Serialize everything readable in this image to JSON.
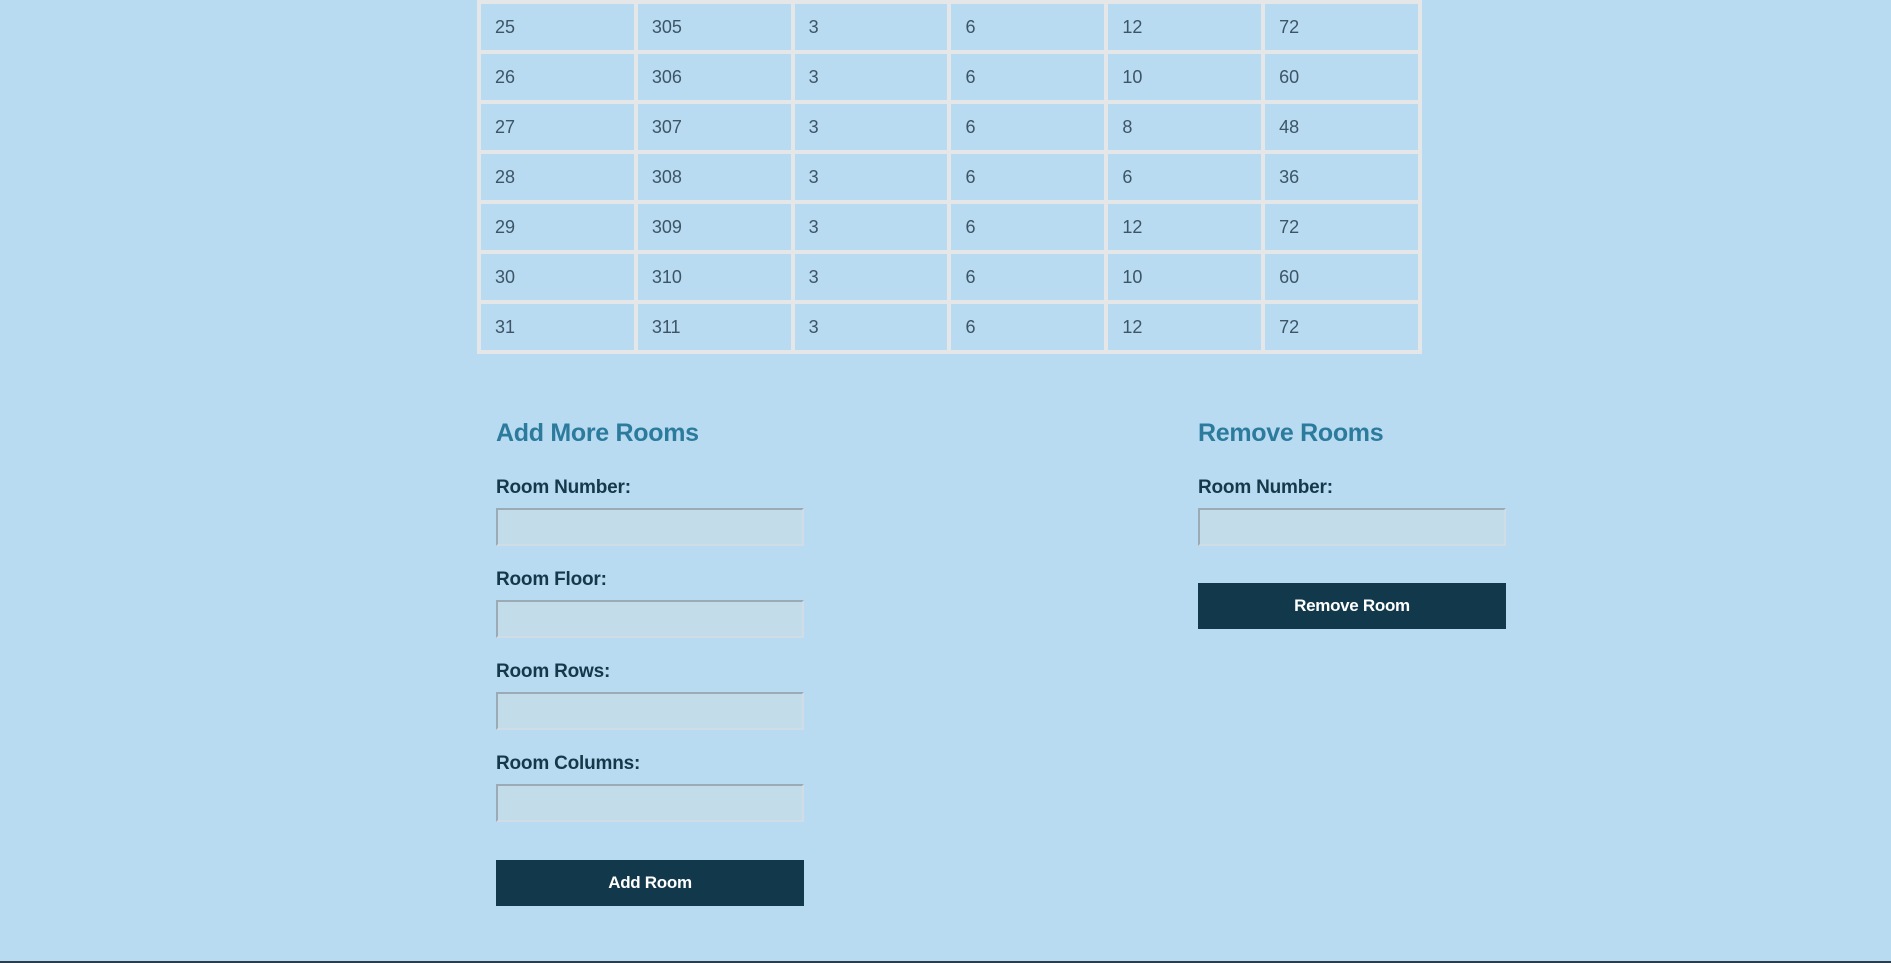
{
  "rooms_table": {
    "rows": [
      [
        "25",
        "305",
        "3",
        "6",
        "12",
        "72"
      ],
      [
        "26",
        "306",
        "3",
        "6",
        "10",
        "60"
      ],
      [
        "27",
        "307",
        "3",
        "6",
        "8",
        "48"
      ],
      [
        "28",
        "308",
        "3",
        "6",
        "6",
        "36"
      ],
      [
        "29",
        "309",
        "3",
        "6",
        "12",
        "72"
      ],
      [
        "30",
        "310",
        "3",
        "6",
        "10",
        "60"
      ],
      [
        "31",
        "311",
        "3",
        "6",
        "12",
        "72"
      ]
    ]
  },
  "add_rooms": {
    "heading": "Add More Rooms",
    "room_number_label": "Room Number:",
    "room_number_value": "",
    "room_floor_label": "Room Floor:",
    "room_floor_value": "",
    "room_rows_label": "Room Rows:",
    "room_rows_value": "",
    "room_columns_label": "Room Columns:",
    "room_columns_value": "",
    "button_label": "Add Room"
  },
  "remove_rooms": {
    "heading": "Remove Rooms",
    "room_number_label": "Room Number:",
    "room_number_value": "",
    "button_label": "Remove Room"
  },
  "colors": {
    "background": "#b8dbf2",
    "heading": "#2c7b9c",
    "label": "#15384a",
    "button": "#12394b",
    "table_border": "#e4e6e8"
  }
}
